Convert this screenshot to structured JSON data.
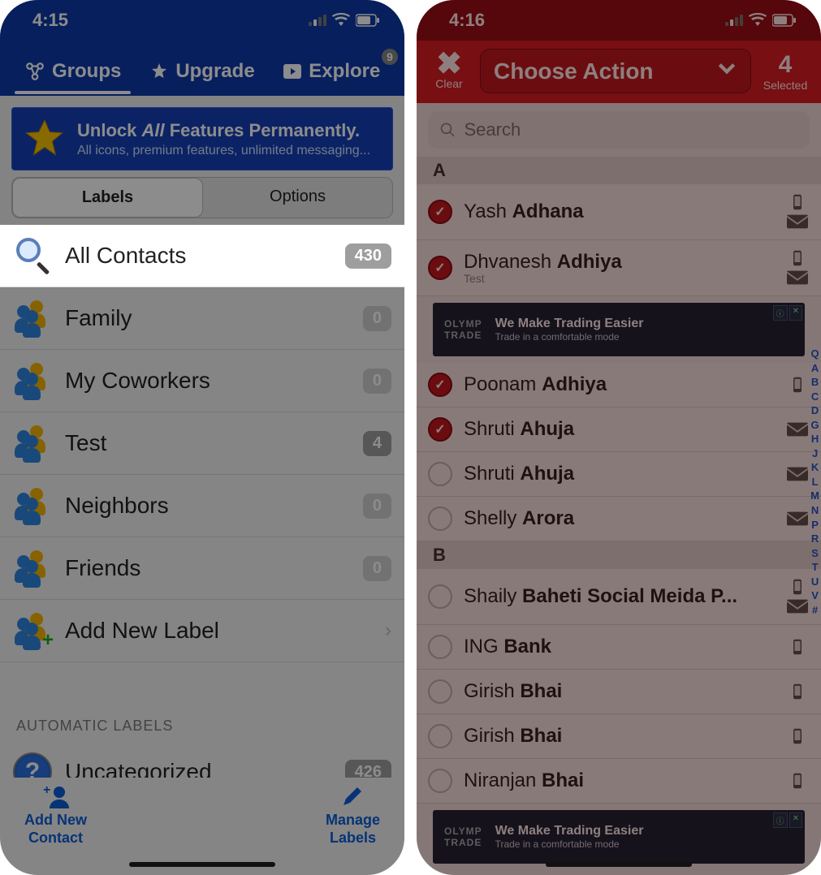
{
  "left": {
    "status_time": "4:15",
    "tabs": {
      "groups": "Groups",
      "upgrade": "Upgrade",
      "explore": "Explore",
      "explore_badge": "9"
    },
    "banner": {
      "title_pre": "Unlock ",
      "title_em": "All",
      "title_post": " Features Permanently.",
      "subtitle": "All icons, premium features, unlimited messaging..."
    },
    "seg": {
      "labels": "Labels",
      "options": "Options"
    },
    "rows": {
      "all": {
        "label": "All Contacts",
        "count": "430"
      },
      "family": {
        "label": "Family",
        "count": "0"
      },
      "coworkers": {
        "label": "My Coworkers",
        "count": "0"
      },
      "test": {
        "label": "Test",
        "count": "4"
      },
      "neighbors": {
        "label": "Neighbors",
        "count": "0"
      },
      "friends": {
        "label": "Friends",
        "count": "0"
      },
      "addnew": {
        "label": "Add New Label"
      }
    },
    "auto_header": "AUTOMATIC LABELS",
    "uncat": {
      "label": "Uncategorized",
      "count": "426"
    },
    "bottom": {
      "add": "Add New\nContact",
      "manage": "Manage\nLabels"
    }
  },
  "right": {
    "status_time": "4:16",
    "clear": "Clear",
    "action": "Choose Action",
    "selected_n": "4",
    "selected_t": "Selected",
    "search_placeholder": "Search",
    "sections": {
      "A": "A",
      "B": "B"
    },
    "contacts": {
      "c1": {
        "first": "Yash ",
        "last": "Adhana",
        "sub": ""
      },
      "c2": {
        "first": "Dhvanesh ",
        "last": "Adhiya",
        "sub": "Test"
      },
      "c3": {
        "first": "Poonam ",
        "last": "Adhiya",
        "sub": ""
      },
      "c4": {
        "first": "Shruti ",
        "last": "Ahuja",
        "sub": ""
      },
      "c5": {
        "first": "Shruti ",
        "last": "Ahuja",
        "sub": ""
      },
      "c6": {
        "first": "Shelly ",
        "last": "Arora",
        "sub": ""
      },
      "c7": {
        "first": "Shaily ",
        "last": "Baheti Social Meida P...",
        "sub": ""
      },
      "c8": {
        "first": "ING ",
        "last": "Bank",
        "sub": ""
      },
      "c9": {
        "first": "Girish ",
        "last": "Bhai",
        "sub": ""
      },
      "c10": {
        "first": "Girish ",
        "last": "Bhai",
        "sub": ""
      },
      "c11": {
        "first": "Niranjan ",
        "last": "Bhai",
        "sub": ""
      }
    },
    "ad": {
      "brand": "OLYMP\nTRADE",
      "line1": "We Make Trading Easier",
      "line2": "Trade in a comfortable mode"
    },
    "index": [
      "Q",
      "A",
      "B",
      "C",
      "D",
      "G",
      "H",
      "J",
      "K",
      "L",
      "M",
      "N",
      "P",
      "R",
      "S",
      "T",
      "U",
      "V",
      "#"
    ]
  }
}
